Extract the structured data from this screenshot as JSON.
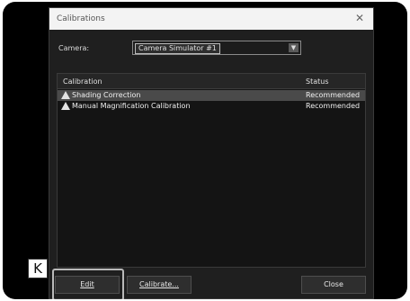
{
  "dialog": {
    "title": "Calibrations",
    "close_glyph": "✕"
  },
  "camera": {
    "label": "Camera:",
    "selected": "Camera Simulator #1",
    "arrow_glyph": "▼"
  },
  "list": {
    "columns": [
      "Calibration",
      "Status"
    ],
    "rows": [
      {
        "name": "Shading Correction",
        "status": "Recommended",
        "icon": "warning-icon",
        "selected": true
      },
      {
        "name": "Manual Magnification Calibration",
        "status": "Recommended",
        "icon": "warning-icon",
        "selected": false
      }
    ]
  },
  "buttons": {
    "edit": "Edit",
    "calibrate": "Calibrate...",
    "close": "Close"
  },
  "callout": {
    "label": "K"
  }
}
